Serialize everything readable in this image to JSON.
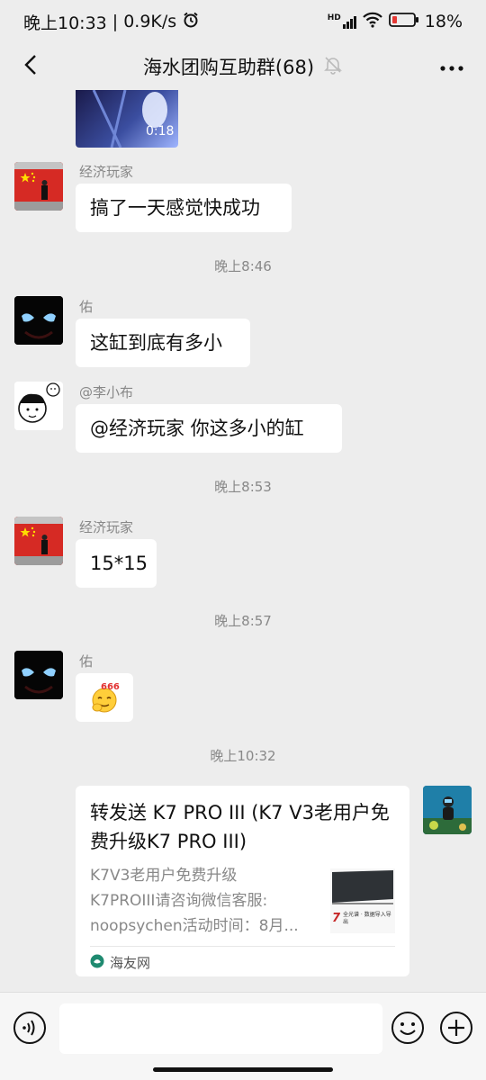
{
  "status": {
    "time": "晚上10:33",
    "speed": "| 0.9K/s",
    "network": "HD",
    "battery": "18%"
  },
  "header": {
    "title": "海水团购互助群(68)"
  },
  "messages": {
    "video": {
      "duration": "0:18"
    },
    "m1": {
      "nick": "经济玩家",
      "text": "搞了一天感觉快成功"
    },
    "t1": "晚上8:46",
    "m2": {
      "nick": "佑",
      "text": "这缸到底有多小"
    },
    "m3": {
      "nick": "@李小布",
      "text": "@经济玩家  你这多小的缸"
    },
    "t2": "晚上8:53",
    "m4": {
      "nick": "经济玩家",
      "text": "15*15"
    },
    "t3": "晚上8:57",
    "m5": {
      "nick": "佑",
      "sticker_text": "666"
    },
    "t4": "晚上10:32",
    "card": {
      "title": "转发送 K7 PRO III (K7 V3老用户免费升级K7 PRO III)",
      "desc1": "K7V3老用户免费升级",
      "desc2": "K7PROIII请咨询微信客服:",
      "desc3": "noopsychen活动时间：8月...",
      "thumb_brand": "7",
      "thumb_small": "全光谱 · 数据导入导出",
      "source": "海友网"
    }
  },
  "colors": {
    "bg": "#ededed",
    "bubble": "#ffffff",
    "battery_low": "#e53935"
  }
}
